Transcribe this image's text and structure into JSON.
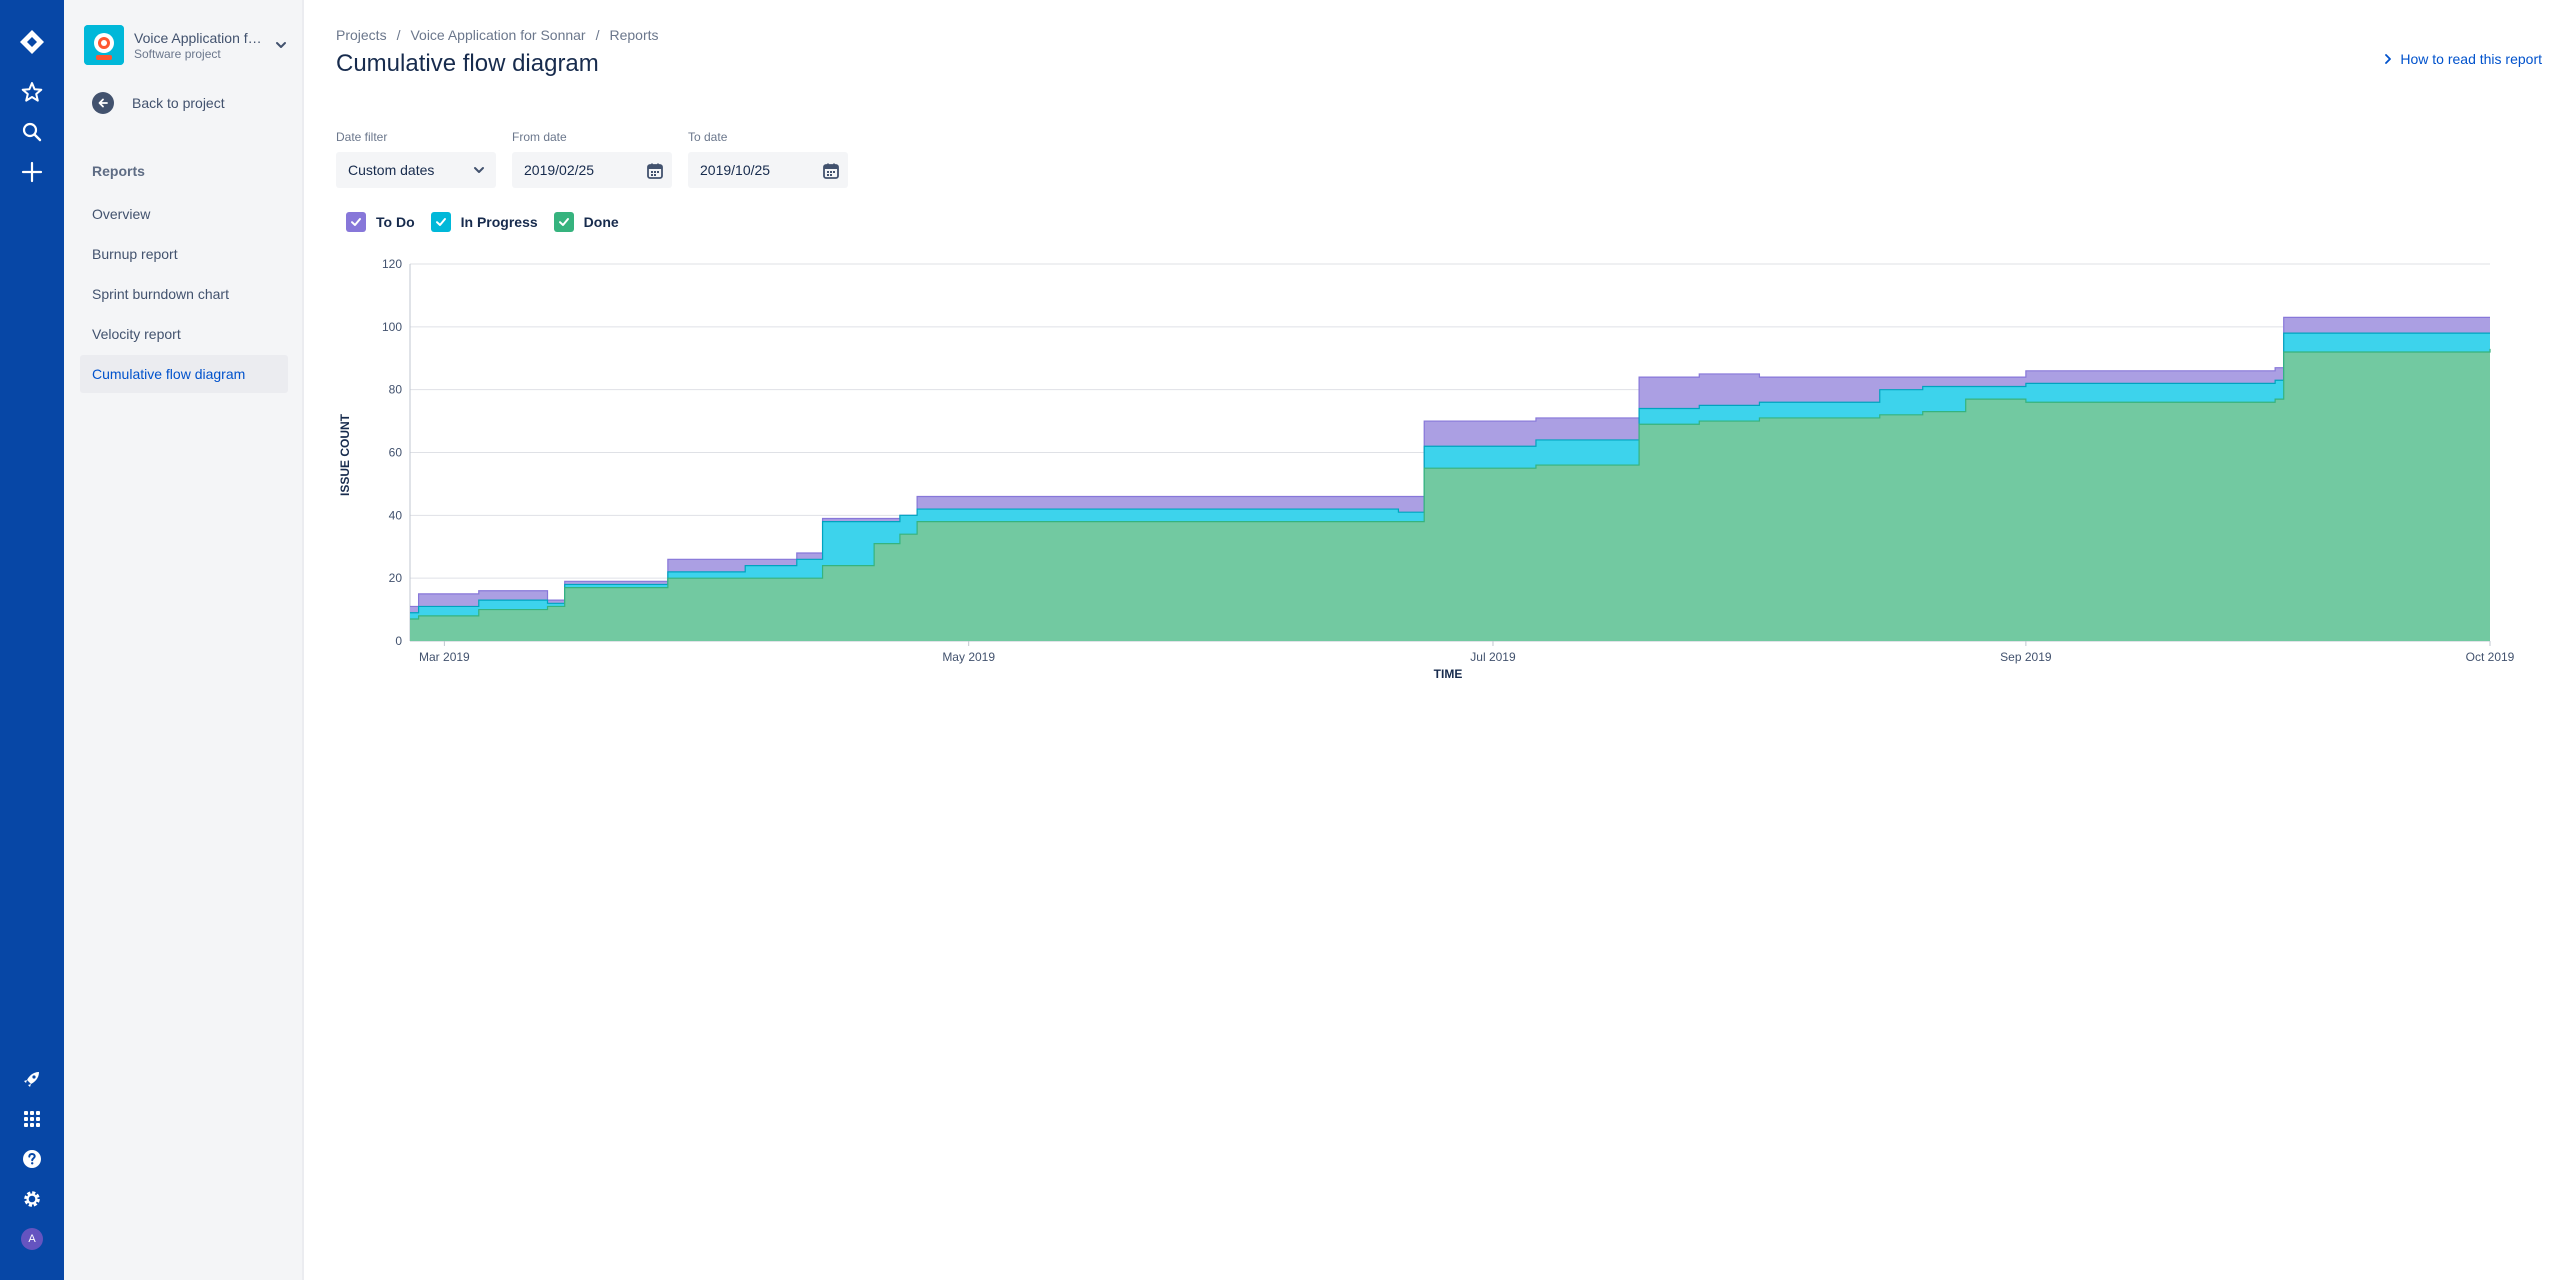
{
  "project": {
    "name": "Voice Application for Sonnar",
    "type": "Software project"
  },
  "sidebar": {
    "back_label": "Back to project",
    "section_title": "Reports",
    "items": [
      {
        "label": "Overview",
        "active": false
      },
      {
        "label": "Burnup report",
        "active": false
      },
      {
        "label": "Sprint burndown chart",
        "active": false
      },
      {
        "label": "Velocity report",
        "active": false
      },
      {
        "label": "Cumulative flow diagram",
        "active": true
      }
    ]
  },
  "user": {
    "avatar_initial": "A"
  },
  "breadcrumb": [
    "Projects",
    "Voice Application for Sonnar",
    "Reports"
  ],
  "page": {
    "title": "Cumulative flow diagram",
    "help_link": "How to read this report"
  },
  "filters": {
    "date_filter": {
      "label": "Date filter",
      "value": "Custom dates"
    },
    "from_date": {
      "label": "From date",
      "value": "2019/02/25"
    },
    "to_date": {
      "label": "To date",
      "value": "2019/10/25"
    }
  },
  "legend": [
    {
      "label": "To Do",
      "color": "#8777d9",
      "checked": true
    },
    {
      "label": "In Progress",
      "color": "#00b8d9",
      "checked": true
    },
    {
      "label": "Done",
      "color": "#36b37e",
      "checked": true
    }
  ],
  "colors": {
    "nav": "#0747a6",
    "accent": "#0052cc",
    "todo_fill": "#ab9fe3",
    "inprogress_fill": "#3dd3ec",
    "done_fill": "#72c9a1"
  },
  "chart_data": {
    "type": "area",
    "stacked": true,
    "xlabel": "TIME",
    "ylabel": "ISSUE COUNT",
    "ylim": [
      0,
      120
    ],
    "yticks": [
      0,
      20,
      40,
      60,
      80,
      100,
      120
    ],
    "xlim": [
      "2019-02-25",
      "2019-10-25"
    ],
    "xticks": [
      {
        "date": "2019-03-01",
        "label": "Mar 2019"
      },
      {
        "date": "2019-05-01",
        "label": "May 2019"
      },
      {
        "date": "2019-07-01",
        "label": "Jul 2019"
      },
      {
        "date": "2019-09-01",
        "label": "Sep 2019"
      },
      {
        "date": "2019-10-25",
        "label": "Oct 2019"
      }
    ],
    "grid": true,
    "x": [
      "2019-02-25",
      "2019-02-26",
      "2019-03-05",
      "2019-03-13",
      "2019-03-15",
      "2019-03-27",
      "2019-04-05",
      "2019-04-11",
      "2019-04-14",
      "2019-04-20",
      "2019-04-23",
      "2019-04-25",
      "2019-06-20",
      "2019-06-23",
      "2019-07-06",
      "2019-07-18",
      "2019-07-25",
      "2019-08-01",
      "2019-08-15",
      "2019-08-20",
      "2019-08-25",
      "2019-09-01",
      "2019-09-30",
      "2019-10-01",
      "2019-10-25"
    ],
    "series": [
      {
        "name": "Done",
        "values": [
          7,
          8,
          10,
          11,
          17,
          20,
          20,
          20,
          24,
          31,
          34,
          38,
          38,
          55,
          56,
          69,
          70,
          71,
          72,
          73,
          77,
          76,
          77,
          92,
          93
        ]
      },
      {
        "name": "In Progress",
        "values": [
          2,
          3,
          3,
          1,
          1,
          2,
          4,
          6,
          14,
          7,
          6,
          4,
          3,
          7,
          8,
          5,
          5,
          5,
          8,
          8,
          4,
          6,
          6,
          6,
          5
        ]
      },
      {
        "name": "To Do",
        "values": [
          2,
          4,
          3,
          1,
          1,
          4,
          2,
          2,
          1,
          1,
          0,
          4,
          5,
          8,
          7,
          10,
          10,
          8,
          4,
          3,
          3,
          4,
          4,
          5,
          5
        ]
      }
    ]
  }
}
